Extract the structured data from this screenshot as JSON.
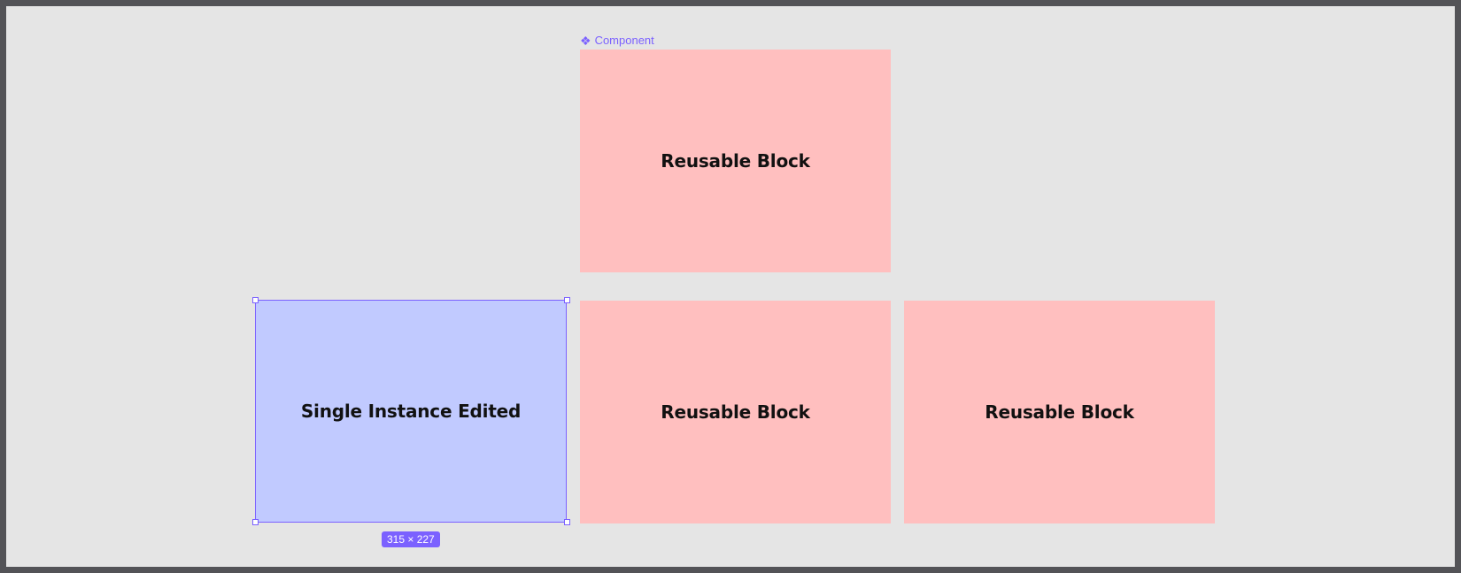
{
  "canvas": {
    "component_label": {
      "icon": "component-icon",
      "text": "Component"
    },
    "main_component": {
      "text": "Reusable Block",
      "fill_color": "#ffbfbf"
    },
    "instances": [
      {
        "text": "Single Instance Edited",
        "fill_color": "#c1caff",
        "selected": true
      },
      {
        "text": "Reusable Block",
        "fill_color": "#ffbfbf",
        "selected": false
      },
      {
        "text": "Reusable Block",
        "fill_color": "#ffbfbf",
        "selected": false
      }
    ],
    "selection": {
      "dimensions_label": "315 × 227",
      "accent_color": "#7b61ff"
    }
  }
}
